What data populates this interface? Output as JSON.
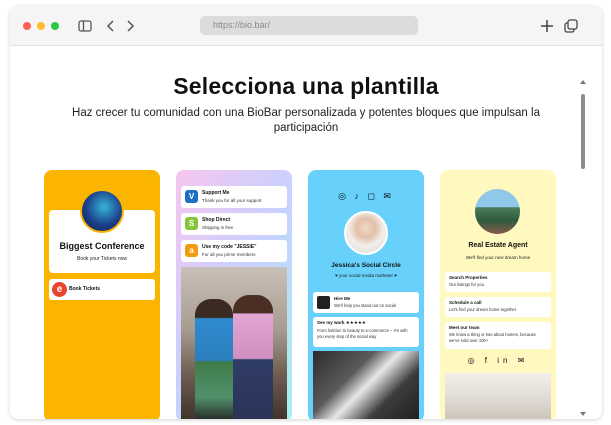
{
  "browser": {
    "url": "https://bio.bar/"
  },
  "page": {
    "headline": "Selecciona una plantilla",
    "subheadline": "Haz crecer tu comunidad con una BioBar personalizada y potentes bloques que impulsan la participación"
  },
  "templates": [
    {
      "title": "Biggest Conference",
      "subtitle": "Book your Tickets now",
      "button_label": "Book Tickets",
      "button_icon_letter": "e",
      "background": "#fbb500"
    },
    {
      "links": [
        {
          "title": "Support Me",
          "subtitle": "Thank you for all your support",
          "icon_letter": "V",
          "icon_color": "#1f6fc5"
        },
        {
          "title": "Shop Direct",
          "subtitle": "Shipping is free",
          "icon_letter": "S",
          "icon_color": "#86c43a"
        },
        {
          "title": "Use my code \"JESSIE\"",
          "subtitle": "For all you prime members",
          "icon_letter": "a",
          "icon_color": "#f39c12"
        }
      ]
    },
    {
      "social_icons": "◎ ♪ ◻ ✉",
      "title": "Jessica's Social Circle",
      "subtitle": "♥ your social media marketer ♥",
      "rows": [
        {
          "title": "Hire Me",
          "text": "We'll help you stand out on social"
        },
        {
          "title": "See my work ★★★★★",
          "text": "From fashion to beauty to e-commerce – I'm with you every step of the social way"
        }
      ],
      "background": "#67d1fb"
    },
    {
      "title": "Real Estate Agent",
      "subtitle": "We'll find your next dream home",
      "rows": [
        {
          "title": "Search Properties",
          "text": "Our listings for you"
        },
        {
          "title": "Schedule a call",
          "text": "Let's find your dream home together"
        },
        {
          "title": "Meet our team",
          "text": "We know a thing or two about homes, because we've sold over 100+"
        }
      ],
      "social_icons": "◎ f in ✉",
      "background": "#fff9bf"
    }
  ]
}
